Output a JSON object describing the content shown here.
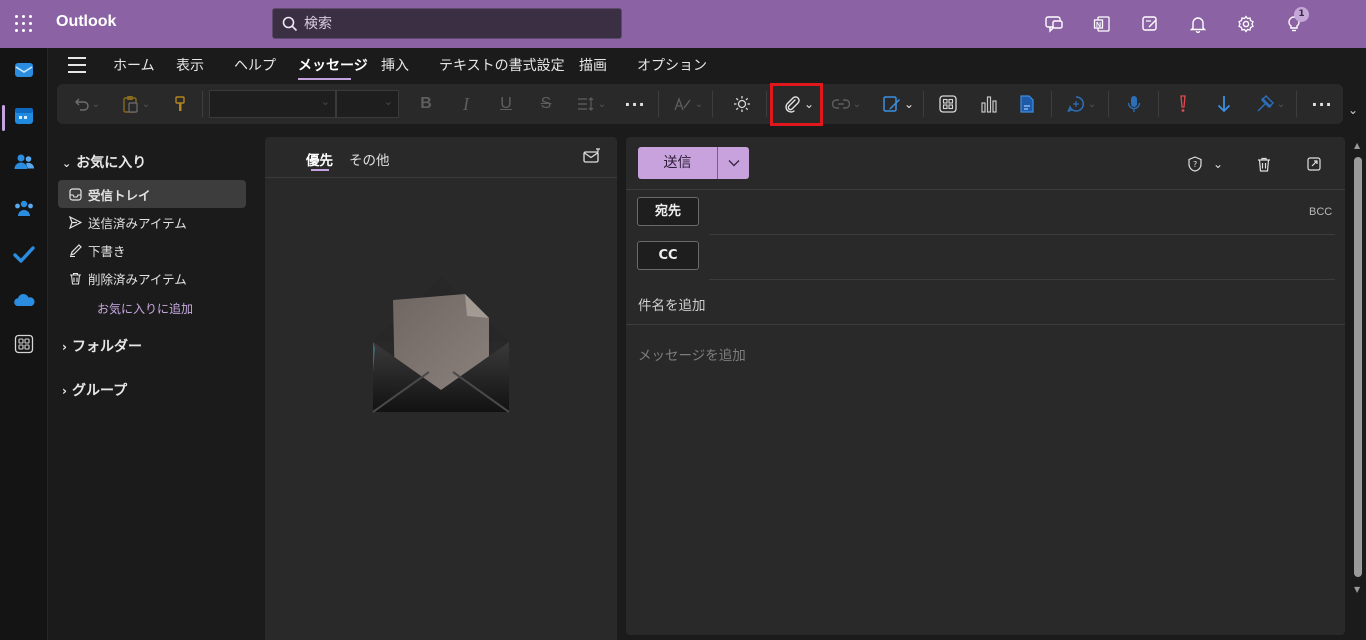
{
  "app": {
    "name": "Outlook"
  },
  "search": {
    "placeholder": "検索"
  },
  "topbar": {
    "notifications_badge": "1"
  },
  "tabs": [
    "ホーム",
    "表示",
    "ヘルプ",
    "メッセージ",
    "挿入",
    "テキストの書式設定",
    "描画",
    "オプション"
  ],
  "active_tab": "メッセージ",
  "ribbon": {
    "icons": [
      "undo-icon",
      "paste-icon",
      "format-painter-icon",
      "font-name-select",
      "font-size-select",
      "bold-icon",
      "italic-icon",
      "underline-icon",
      "strikethrough-icon",
      "line-spacing-icon",
      "more-icon",
      "editor-icon",
      "theme-icon",
      "attach-file-icon",
      "link-icon",
      "signature-icon",
      "apps-icon",
      "chart-icon",
      "loop-icon",
      "copilot-icon",
      "dictate-icon",
      "importance-high-icon",
      "importance-low-icon",
      "sensitivity-icon",
      "more-options-icon"
    ],
    "highlighted": "attach-file-icon"
  },
  "folders": {
    "favorites_label": "お気に入り",
    "items": [
      "受信トレイ",
      "送信済みアイテム",
      "下書き",
      "削除済みアイテム"
    ],
    "selected": "受信トレイ",
    "add_favorite_link": "お気に入りに追加",
    "folders_label": "フォルダー",
    "groups_label": "グループ"
  },
  "message_list": {
    "tabs": [
      "優先",
      "その他"
    ],
    "active_tab": "優先"
  },
  "compose": {
    "send_label": "送信",
    "to_label": "宛先",
    "cc_label": "CC",
    "bcc_label": "BCC",
    "subject_placeholder": "件名を追加",
    "body_placeholder": "メッセージを追加"
  },
  "colors": {
    "topbar": "#8b63a4",
    "accent": "#c5a3e0",
    "highlight_box": "#e0181e",
    "send_button": "#c8a2dc"
  }
}
